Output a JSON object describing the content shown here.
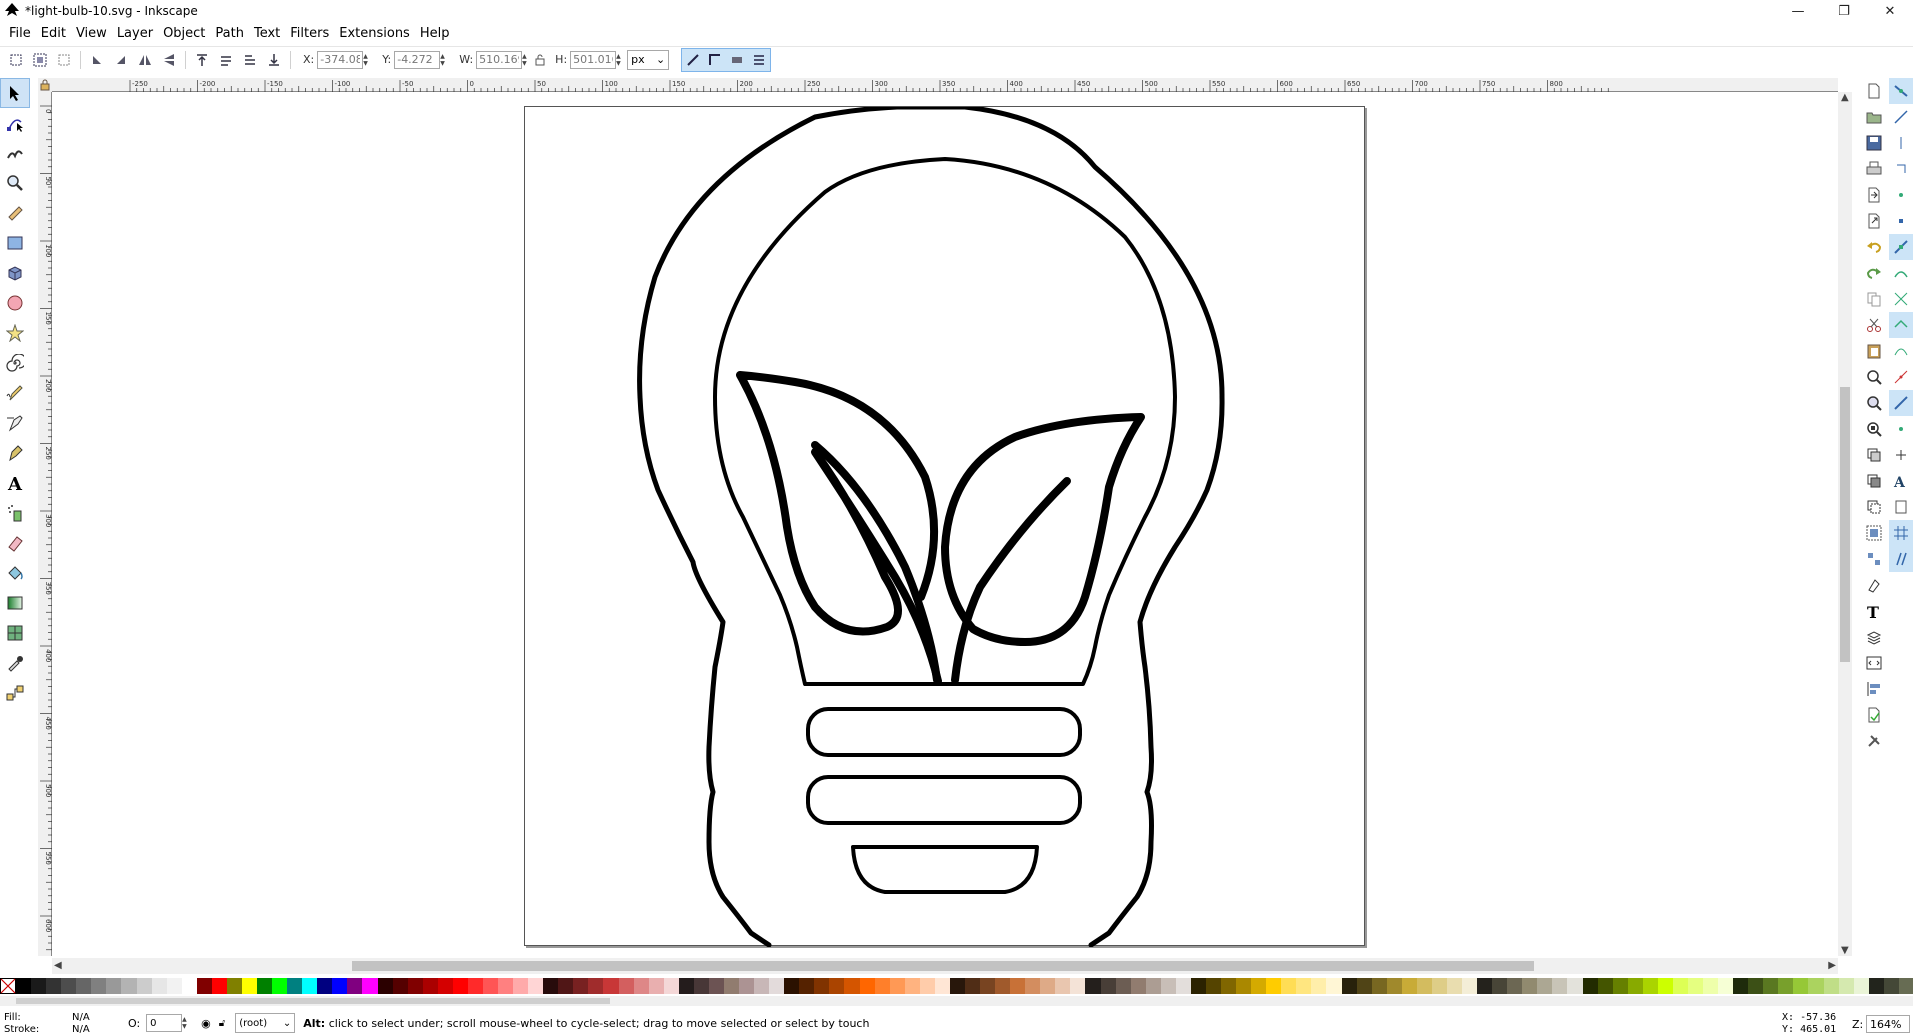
{
  "window": {
    "title": "*light-bulb-10.svg - Inkscape",
    "minimize": "—",
    "restore": "❐",
    "close": "✕"
  },
  "menu": [
    "File",
    "Edit",
    "View",
    "Layer",
    "Object",
    "Path",
    "Text",
    "Filters",
    "Extensions",
    "Help"
  ],
  "toolbar": {
    "x_label": "X:",
    "x_value": "-374.08",
    "y_label": "Y:",
    "y_value": "-4.272",
    "w_label": "W:",
    "w_value": "510.169",
    "h_label": "H:",
    "h_value": "501.016",
    "unit": "px"
  },
  "ruler": {
    "h_ticks": [
      "-250",
      "-200",
      "-150",
      "-100",
      "-50",
      "0",
      "50",
      "100",
      "150",
      "200",
      "250",
      "300",
      "350",
      "400",
      "450",
      "500",
      "550",
      "600",
      "650",
      "700",
      "750",
      "800"
    ],
    "v_ticks": [
      "0",
      "50",
      "100",
      "150",
      "200",
      "250",
      "300",
      "350",
      "400",
      "450",
      "500",
      "550",
      "600",
      "650",
      "700"
    ]
  },
  "palette": {
    "colors": [
      "#000000",
      "#1a1a1a",
      "#333333",
      "#4d4d4d",
      "#666666",
      "#808080",
      "#999999",
      "#b3b3b3",
      "#cccccc",
      "#e6e6e6",
      "#f2f2f2",
      "#ffffff",
      "#800000",
      "#ff0000",
      "#808000",
      "#ffff00",
      "#008000",
      "#00ff00",
      "#008080",
      "#00ffff",
      "#000080",
      "#0000ff",
      "#800080",
      "#ff00ff",
      "#2b0000",
      "#550000",
      "#800000",
      "#aa0000",
      "#d40000",
      "#ff0000",
      "#ff2a2a",
      "#ff5555",
      "#ff8080",
      "#ffaaaa",
      "#ffd5d5",
      "#280b0b",
      "#501616",
      "#782121",
      "#a02c2c",
      "#c83737",
      "#d35f5f",
      "#de8787",
      "#e9afaf",
      "#f4d7d7",
      "#241c1c",
      "#483737",
      "#6c5353",
      "#917c6f",
      "#ac9393",
      "#c8b7b7",
      "#e3dbdb",
      "#2b1100",
      "#552200",
      "#803300",
      "#aa4400",
      "#d45500",
      "#ff6600",
      "#ff7f2a",
      "#ff9955",
      "#ffb380",
      "#ffccaa",
      "#ffe6d5",
      "#28170b",
      "#502d16",
      "#784421",
      "#a05a2c",
      "#c87137",
      "#d38d5f",
      "#deaa87",
      "#e9c6af",
      "#f4e3d7",
      "#241f1c",
      "#483e37",
      "#6c5d53",
      "#917c6f",
      "#ac9d93",
      "#c8beb7",
      "#e3dedb",
      "#2b2200",
      "#554400",
      "#806600",
      "#aa8800",
      "#d4aa00",
      "#ffcc00",
      "#ffdd55",
      "#ffe680",
      "#ffeeaa",
      "#fff6d5",
      "#28220b",
      "#504416",
      "#786721",
      "#a0892c",
      "#c8ab37",
      "#d3bc5f",
      "#decd87",
      "#e9ddaf",
      "#f4eed7",
      "#24221c",
      "#484537",
      "#6c6753",
      "#918a6f",
      "#aca793",
      "#c8c4b7",
      "#e3e2db",
      "#222b00",
      "#445500",
      "#668000",
      "#88aa00",
      "#aad400",
      "#ccff00",
      "#ddff55",
      "#e5ff80",
      "#eeffaa",
      "#f6ffd5",
      "#1e2b0b",
      "#3c5016",
      "#5a7821",
      "#78a02c",
      "#96c837",
      "#abd35f",
      "#c0de87",
      "#d5e9af",
      "#eaf4d7",
      "#22241c",
      "#444837",
      "#676c53"
    ]
  },
  "status": {
    "fill_label": "Fill:",
    "fill_value": "N/A",
    "stroke_label": "Stroke:",
    "stroke_value": "N/A",
    "opacity_label": "O:",
    "opacity_value": "0",
    "layer": "(root)",
    "message_bold": "Alt:",
    "message": " click to select under; scroll mouse-wheel to cycle-select; drag to move selected or select by touch",
    "cursor_x_label": "X:",
    "cursor_x": "-57.36",
    "cursor_y_label": "Y:",
    "cursor_y": "465.01",
    "zoom_label": "Z:",
    "zoom": "164%"
  },
  "tools": [
    "select-tool",
    "node-tool",
    "tweak-tool",
    "zoom-tool",
    "measure-tool",
    "rectangle-tool",
    "3d-box-tool",
    "ellipse-tool",
    "star-tool",
    "spiral-tool",
    "pencil-tool",
    "pen-tool",
    "calligraphy-tool",
    "text-tool",
    "spray-tool",
    "eraser-tool",
    "paint-bucket-tool",
    "gradient-tool",
    "mesh-tool",
    "dropper-tool",
    "connector-tool"
  ]
}
